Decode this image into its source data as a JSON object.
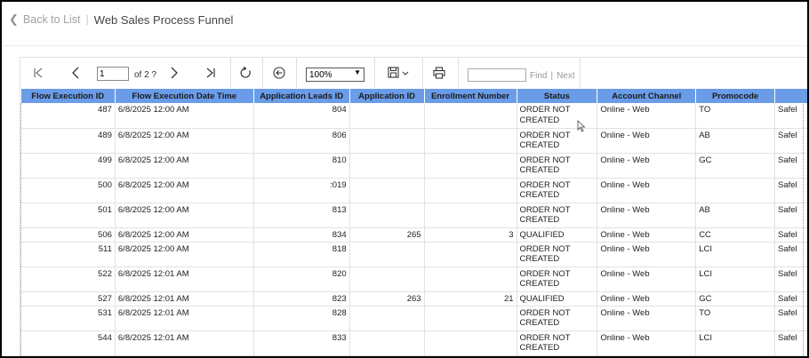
{
  "header": {
    "back_label": "Back to List",
    "title": "Web Sales Process Funnel"
  },
  "toolbar": {
    "page_value": "1",
    "of_pages": "of 2 ?",
    "zoom": "100%",
    "find_label": "Find",
    "next_label": "Next"
  },
  "table": {
    "columns": [
      "Flow Execution ID",
      "Flow Execution Date Time",
      "Application Leads ID",
      "Application ID",
      "Enrollment Number",
      "Status",
      "Account Channel",
      "Promocode",
      ""
    ],
    "rows": [
      {
        "id": "487",
        "dt": "6/8/2025 12:00 AM",
        "lead": "804",
        "app": "",
        "enroll": "",
        "status1": "ORDER NOT",
        "status2": "CREATED",
        "channel": "Online - Web",
        "promo": "TO",
        "extra": "Safel"
      },
      {
        "id": "489",
        "dt": "6/8/2025 12:00 AM",
        "lead": "806",
        "app": "",
        "enroll": "",
        "status1": "ORDER NOT",
        "status2": "CREATED",
        "channel": "Online - Web",
        "promo": "AB",
        "extra": "Safel"
      },
      {
        "id": "499",
        "dt": "6/8/2025 12:00 AM",
        "lead": "810",
        "app": "",
        "enroll": "",
        "status1": "ORDER NOT",
        "status2": "CREATED",
        "channel": "Online - Web",
        "promo": "GC",
        "extra": "Safel"
      },
      {
        "id": "500",
        "dt": "6/8/2025 12:00 AM",
        "lead": ":019",
        "app": "",
        "enroll": "",
        "status1": "ORDER NOT",
        "status2": "CREATED",
        "channel": "Online - Web",
        "promo": "",
        "extra": "Safel"
      },
      {
        "id": "501",
        "dt": "6/8/2025 12:00 AM",
        "lead": "813",
        "app": "",
        "enroll": "",
        "status1": "ORDER NOT",
        "status2": "CREATED",
        "channel": "Online - Web",
        "promo": "AB",
        "extra": "Safel"
      },
      {
        "id": "506",
        "dt": "6/8/2025 12:00 AM",
        "lead": "834",
        "app": "265",
        "enroll": "3",
        "status1": "QUALIFIED",
        "status2": "",
        "channel": "Online - Web",
        "promo": "CC",
        "extra": "Safel"
      },
      {
        "id": "511",
        "dt": "6/8/2025 12:00 AM",
        "lead": "818",
        "app": "",
        "enroll": "",
        "status1": "ORDER NOT",
        "status2": "CREATED",
        "channel": "Online - Web",
        "promo": "LCI",
        "extra": "Safel"
      },
      {
        "id": "522",
        "dt": "6/8/2025 12:01 AM",
        "lead": "820",
        "app": "",
        "enroll": "",
        "status1": "ORDER NOT",
        "status2": "CREATED",
        "channel": "Online - Web",
        "promo": "LCI",
        "extra": "Safel"
      },
      {
        "id": "527",
        "dt": "6/8/2025 12:01 AM",
        "lead": "823",
        "app": "263",
        "enroll": "21",
        "status1": "QUALIFIED",
        "status2": "",
        "channel": "Online - Web",
        "promo": "GC",
        "extra": "Safel"
      },
      {
        "id": "531",
        "dt": "6/8/2025 12:01 AM",
        "lead": "828",
        "app": "",
        "enroll": "",
        "status1": "ORDER NOT",
        "status2": "CREATED",
        "channel": "Online - Web",
        "promo": "TO",
        "extra": "Safel"
      },
      {
        "id": "544",
        "dt": "6/8/2025 12:01 AM",
        "lead": "833",
        "app": "",
        "enroll": "",
        "status1": "ORDER NOT",
        "status2": "CREATED",
        "channel": "Online - Web",
        "promo": "LCI",
        "extra": "Safel"
      }
    ]
  },
  "colors": {
    "header_bg": "#6a9ce8"
  }
}
